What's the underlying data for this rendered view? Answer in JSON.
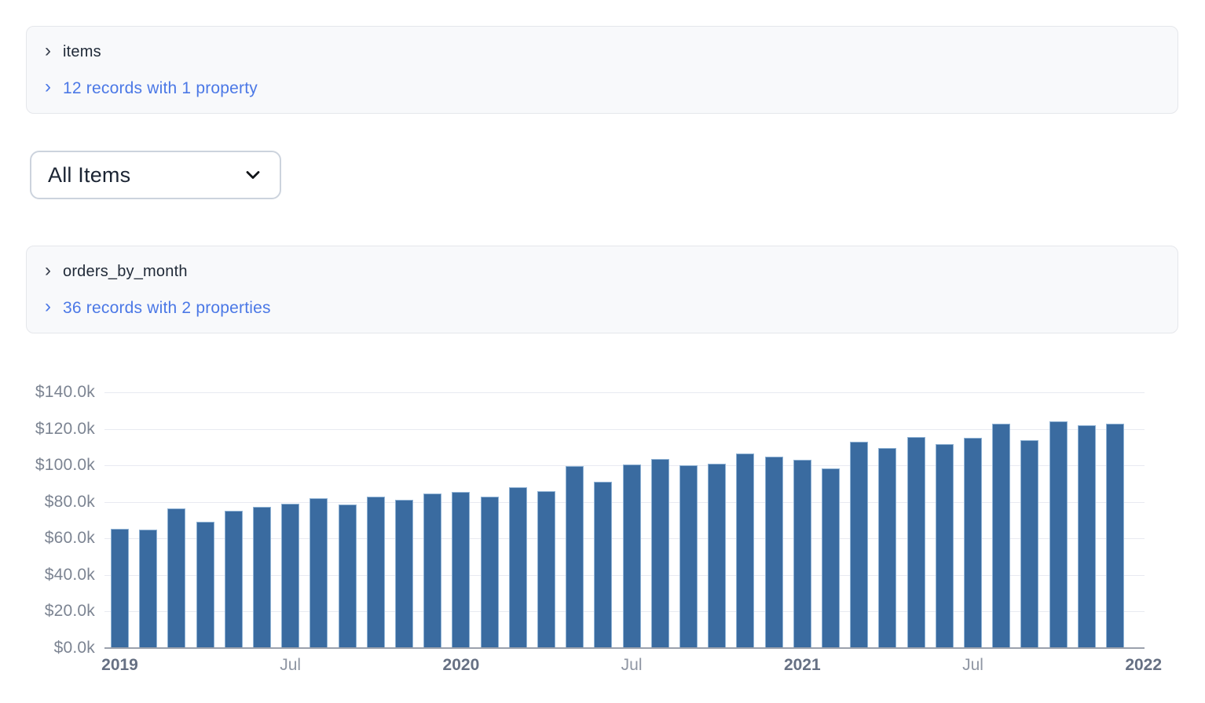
{
  "queries": [
    {
      "title": "items",
      "summary_link": "12 records with 1 property"
    },
    {
      "title": "orders_by_month",
      "summary_link": "36 records with 2 properties"
    }
  ],
  "icons": {
    "expand_chevron": "›"
  },
  "filter_dropdown": {
    "value": "All Items"
  },
  "colors": {
    "bar_fill": "#3a6ba0",
    "bar_stroke": "#8fb2d4",
    "link_blue": "#4b78e6",
    "gridline": "#e8eaf1",
    "axis_line": "#9ba1ac",
    "panel_bg": "#f8f9fb",
    "panel_border": "#e5e7eb"
  },
  "chart_data": {
    "type": "bar",
    "title": "orders_by_month",
    "xlabel": "",
    "ylabel": "",
    "ylim": [
      0,
      140000
    ],
    "grid": true,
    "legend": false,
    "categories": [
      "2019-01",
      "2019-02",
      "2019-03",
      "2019-04",
      "2019-05",
      "2019-06",
      "2019-07",
      "2019-08",
      "2019-09",
      "2019-10",
      "2019-11",
      "2019-12",
      "2020-01",
      "2020-02",
      "2020-03",
      "2020-04",
      "2020-05",
      "2020-06",
      "2020-07",
      "2020-08",
      "2020-09",
      "2020-10",
      "2020-11",
      "2020-12",
      "2021-01",
      "2021-02",
      "2021-03",
      "2021-04",
      "2021-05",
      "2021-06",
      "2021-07",
      "2021-08",
      "2021-09",
      "2021-10",
      "2021-11",
      "2021-12"
    ],
    "values": [
      65500,
      65000,
      76500,
      69000,
      75000,
      77500,
      79000,
      82000,
      78500,
      83000,
      81000,
      84500,
      85500,
      83000,
      88000,
      86000,
      99500,
      91000,
      100500,
      103500,
      100000,
      101000,
      106500,
      105000,
      103000,
      98500,
      113000,
      109500,
      115500,
      111500,
      115000,
      123000,
      114000,
      124000,
      122000,
      123000
    ],
    "y_ticks": [
      {
        "value": 0,
        "label": "$0.0k"
      },
      {
        "value": 20000,
        "label": "$20.0k"
      },
      {
        "value": 40000,
        "label": "$40.0k"
      },
      {
        "value": 60000,
        "label": "$60.0k"
      },
      {
        "value": 80000,
        "label": "$80.0k"
      },
      {
        "value": 100000,
        "label": "$100.0k"
      },
      {
        "value": 120000,
        "label": "$120.0k"
      },
      {
        "value": 140000,
        "label": "$140.0k"
      }
    ],
    "x_ticks": [
      {
        "label": "2019",
        "bold": true,
        "slot": 0
      },
      {
        "label": "Jul",
        "bold": false,
        "slot": 6
      },
      {
        "label": "2020",
        "bold": true,
        "slot": 12
      },
      {
        "label": "Jul",
        "bold": false,
        "slot": 18
      },
      {
        "label": "2021",
        "bold": true,
        "slot": 24
      },
      {
        "label": "Jul",
        "bold": false,
        "slot": 30
      },
      {
        "label": "2022",
        "bold": true,
        "slot": 36
      }
    ]
  }
}
